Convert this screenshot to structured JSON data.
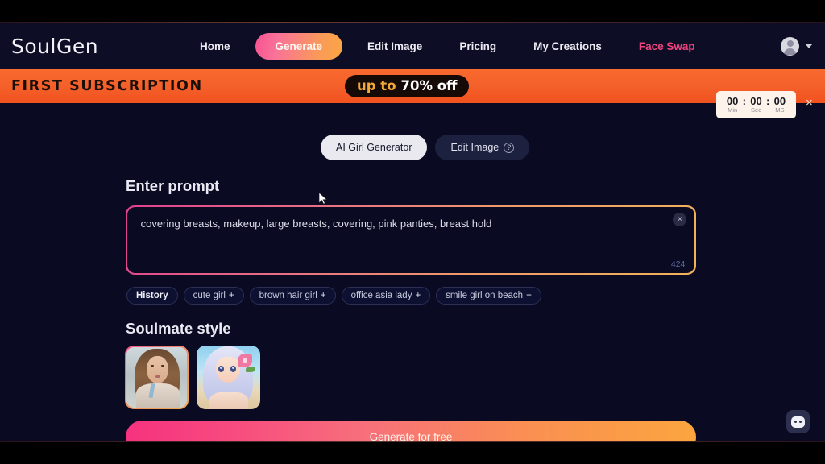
{
  "brand": {
    "logo": "SoulGen"
  },
  "nav": {
    "items": [
      {
        "label": "Home",
        "kind": "link"
      },
      {
        "label": "Generate",
        "kind": "pill-active"
      },
      {
        "label": "Edit Image",
        "kind": "link"
      },
      {
        "label": "Pricing",
        "kind": "link"
      },
      {
        "label": "My Creations",
        "kind": "link"
      },
      {
        "label": "Face Swap",
        "kind": "link-highlight"
      }
    ],
    "account": {
      "avatar_icon": "user-avatar-icon",
      "chevron_icon": "chevron-down-icon"
    }
  },
  "promo": {
    "title": "FIRST SUBSCRIPTION",
    "badge_prefix": "up to",
    "badge_value": "70% off",
    "timer": {
      "minutes": "00",
      "seconds": "00",
      "milliseconds": "00",
      "separator": ":",
      "minutes_label": "Min",
      "seconds_label": "Sec",
      "milliseconds_label": "MS"
    },
    "close_icon": "close-icon",
    "close_label": "×"
  },
  "mode_tabs": [
    {
      "label": "AI Girl Generator",
      "active": true
    },
    {
      "label": "Edit Image",
      "active": false,
      "help_badge": "?"
    }
  ],
  "prompt": {
    "title": "Enter prompt",
    "value": "covering breasts, makeup, large breasts, covering, pink panties, breast hold",
    "placeholder": "Enter prompt",
    "char_count": "424",
    "clear_icon": "close-icon",
    "clear_label": "×"
  },
  "tags": {
    "history_label": "History",
    "items": [
      {
        "label": "cute girl",
        "add": "+"
      },
      {
        "label": "brown hair girl",
        "add": "+"
      },
      {
        "label": "office asia lady",
        "add": "+"
      },
      {
        "label": "smile girl on beach",
        "add": "+"
      }
    ]
  },
  "style": {
    "title": "Soulmate style",
    "options": [
      {
        "name": "realistic-girl-style",
        "selected": true
      },
      {
        "name": "anime-girl-style",
        "selected": false
      }
    ]
  },
  "generate": {
    "label": "Generate for free"
  },
  "chat": {
    "icon": "chat-bubble-icon"
  },
  "colors": {
    "page_bg": "#0a0a23",
    "nav_bg": "#0d0d26",
    "promo_bg": "#f4602a",
    "accent_pink": "#f6327f",
    "accent_orange": "#fba53f",
    "faceswap_pink": "#f0427d",
    "timer_bg": "#fdf3ea"
  }
}
